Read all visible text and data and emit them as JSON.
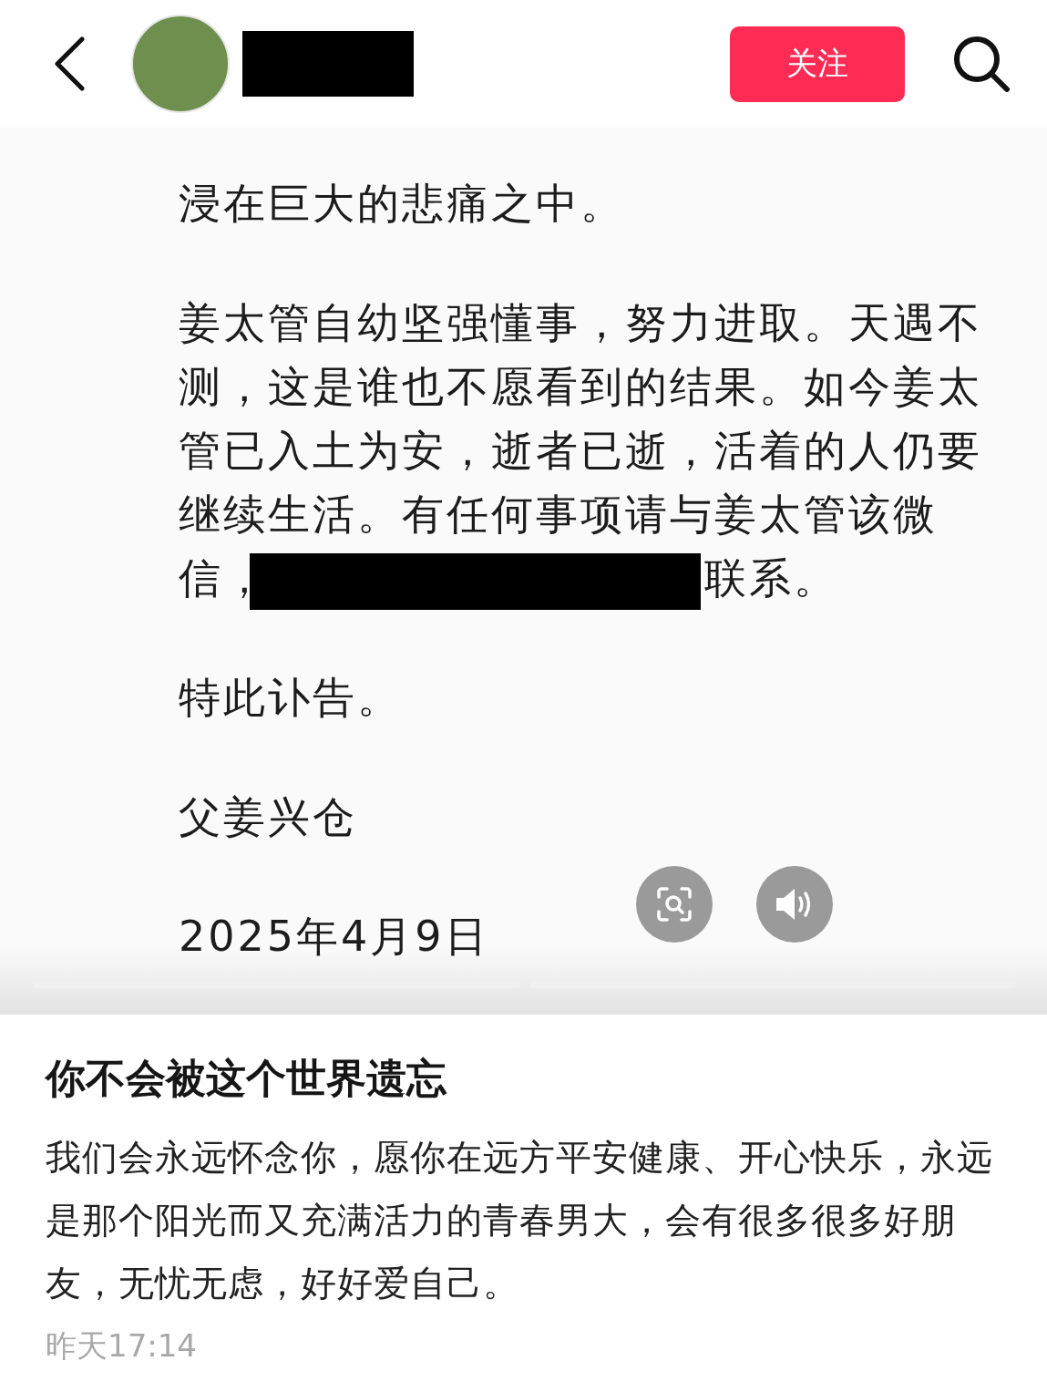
{
  "header": {
    "follow_button": "关注"
  },
  "post_image": {
    "paragraphs": [
      {
        "text": "浸在巨大的悲痛之中。"
      },
      {
        "text": "姜太管自幼坚强懂事，努力进取。天遇不测，这是谁也不愿看到的结果。如今姜太管已入土为安，逝者已逝，活着的人仍要继续生活。有任何事项请与姜太管该微信，",
        "after_redaction": "联系。"
      },
      {
        "text": "特此讣告。"
      },
      {
        "text": "父姜兴仓"
      },
      {
        "text": "2025年4月9日"
      }
    ]
  },
  "caption": {
    "title": "你不会被这个世界遗忘",
    "body": "我们会永远怀念你，愿你在远方平安健康、开心快乐，永远是那个阳光而又充满活力的青春男大，会有很多很多好朋友，无忧无虑，好好爱自己。",
    "time": "昨天17:14"
  }
}
